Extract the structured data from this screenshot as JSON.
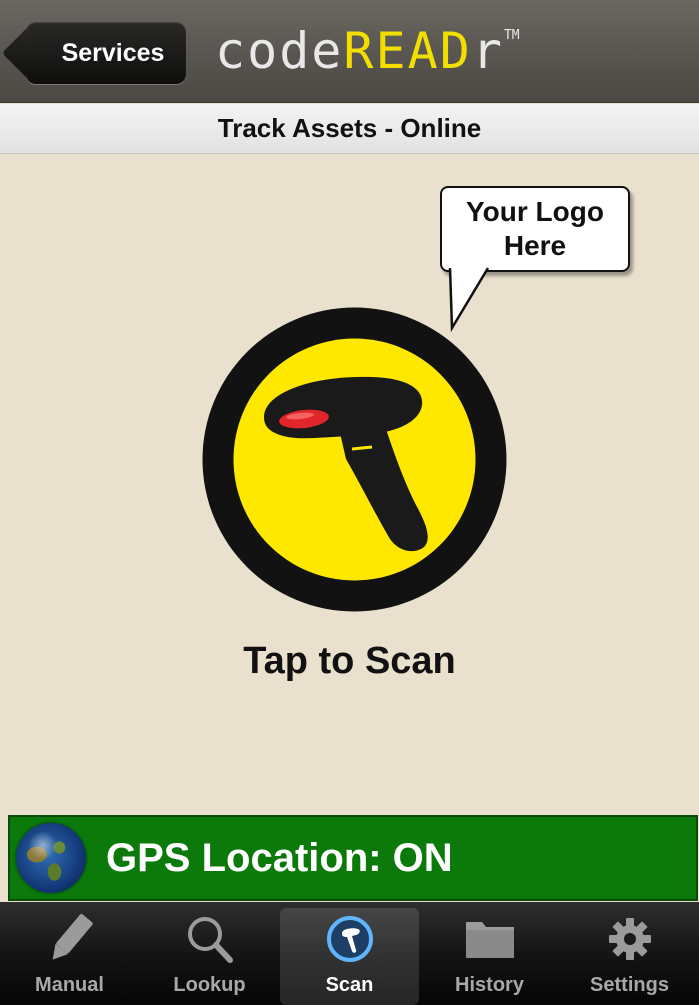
{
  "navbar": {
    "back_label": "Services",
    "brand_prefix": "code",
    "brand_highlight": "READ",
    "brand_suffix": "r",
    "brand_tm": "TM"
  },
  "subtitle": "Track Assets - Online",
  "bubble": {
    "line1": "Your Logo",
    "line2": "Here"
  },
  "scan": {
    "label": "Tap to Scan"
  },
  "gps": {
    "label": "GPS Location: ON"
  },
  "tabs": [
    {
      "label": "Manual",
      "icon": "pencil-icon"
    },
    {
      "label": "Lookup",
      "icon": "magnifier-icon"
    },
    {
      "label": "Scan",
      "icon": "scanner-icon",
      "active": true
    },
    {
      "label": "History",
      "icon": "folder-icon"
    },
    {
      "label": "Settings",
      "icon": "gear-icon"
    }
  ],
  "colors": {
    "brand_accent": "#f2df00",
    "scan_yellow": "#ffe800",
    "gps_green": "#0b7a0b",
    "background": "#e9e1cd"
  }
}
